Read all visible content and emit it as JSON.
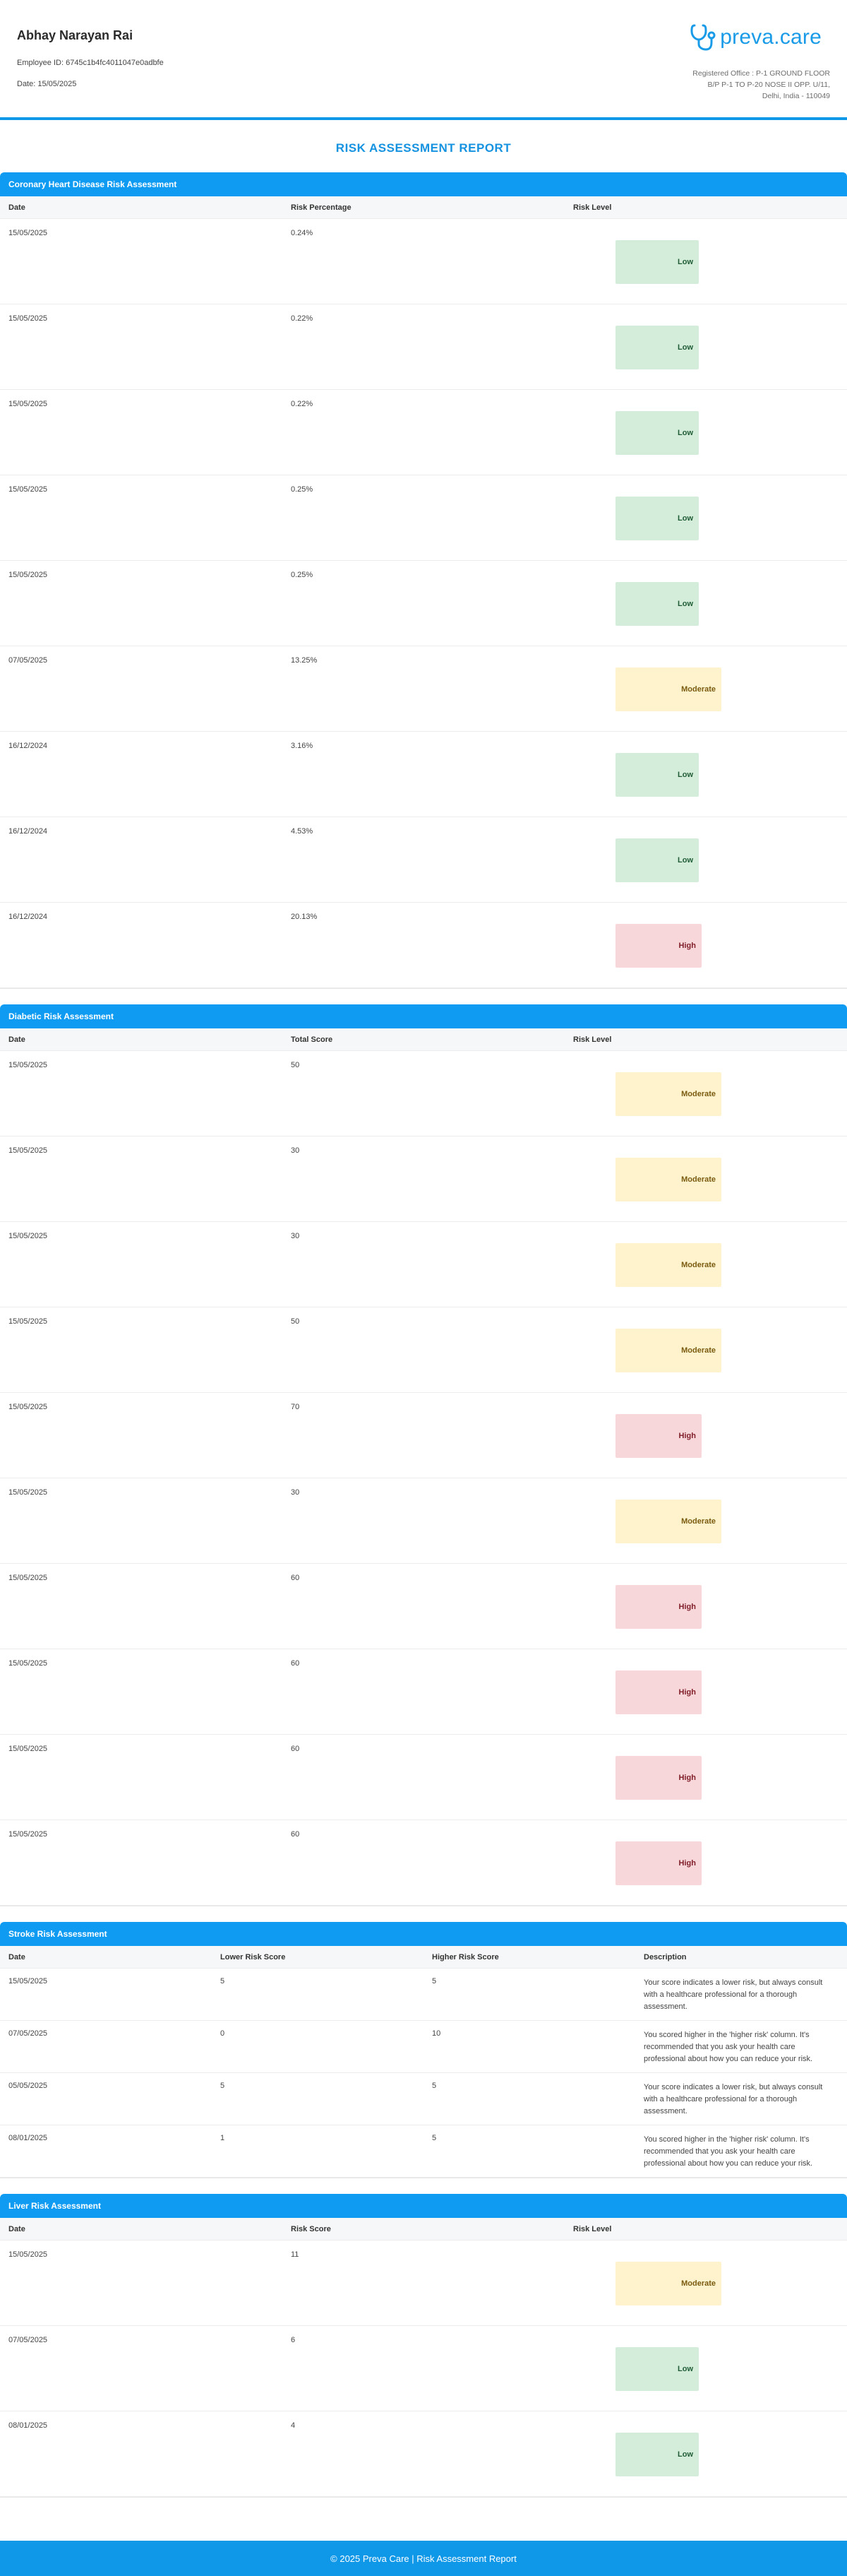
{
  "header": {
    "name": "Abhay Narayan Rai",
    "employee_id": "Employee ID: 6745c1b4fc4011047e0adbfe",
    "date": "Date: 15/05/2025",
    "logo_text": "preva.care",
    "address_lines": [
      "Registered Office : P-1 GROUND FLOOR",
      "B/P P-1 TO P-20 NOSE II OPP. U/11,",
      "Delhi, India - 110049"
    ]
  },
  "report_title": "RISK ASSESSMENT REPORT",
  "colors": {
    "accent": "#0f9bf1",
    "low_bg": "#d4eddb",
    "moderate_bg": "#fff3cd",
    "high_bg": "#f8d7da"
  },
  "coronary": {
    "title": "Coronary Heart Disease Risk Assessment",
    "headers": [
      "Date",
      "Risk Percentage",
      "Risk Level"
    ],
    "rows": [
      {
        "date": "15/05/2025",
        "value": "0.24%",
        "level": "Low"
      },
      {
        "date": "15/05/2025",
        "value": "0.22%",
        "level": "Low"
      },
      {
        "date": "15/05/2025",
        "value": "0.22%",
        "level": "Low"
      },
      {
        "date": "15/05/2025",
        "value": "0.25%",
        "level": "Low"
      },
      {
        "date": "15/05/2025",
        "value": "0.25%",
        "level": "Low"
      },
      {
        "date": "07/05/2025",
        "value": "13.25%",
        "level": "Moderate"
      },
      {
        "date": "16/12/2024",
        "value": "3.16%",
        "level": "Low"
      },
      {
        "date": "16/12/2024",
        "value": "4.53%",
        "level": "Low"
      },
      {
        "date": "16/12/2024",
        "value": "20.13%",
        "level": "High"
      }
    ]
  },
  "diabetic": {
    "title": "Diabetic Risk Assessment",
    "headers": [
      "Date",
      "Total Score",
      "Risk Level"
    ],
    "rows": [
      {
        "date": "15/05/2025",
        "value": "50",
        "level": "Moderate"
      },
      {
        "date": "15/05/2025",
        "value": "30",
        "level": "Moderate"
      },
      {
        "date": "15/05/2025",
        "value": "30",
        "level": "Moderate"
      },
      {
        "date": "15/05/2025",
        "value": "50",
        "level": "Moderate"
      },
      {
        "date": "15/05/2025",
        "value": "70",
        "level": "High"
      },
      {
        "date": "15/05/2025",
        "value": "30",
        "level": "Moderate"
      },
      {
        "date": "15/05/2025",
        "value": "60",
        "level": "High"
      },
      {
        "date": "15/05/2025",
        "value": "60",
        "level": "High"
      },
      {
        "date": "15/05/2025",
        "value": "60",
        "level": "High"
      },
      {
        "date": "15/05/2025",
        "value": "60",
        "level": "High"
      }
    ]
  },
  "stroke": {
    "title": "Stroke Risk Assessment",
    "headers": [
      "Date",
      "Lower Risk Score",
      "Higher Risk Score",
      "Description"
    ],
    "rows": [
      {
        "date": "15/05/2025",
        "lower": "5",
        "higher": "5",
        "description": "Your score indicates a lower risk, but always consult with a healthcare professional for a thorough assessment."
      },
      {
        "date": "07/05/2025",
        "lower": "0",
        "higher": "10",
        "description": "You scored higher in the 'higher risk' column. It's recommended that you ask your health care professional about how you can reduce your risk."
      },
      {
        "date": "05/05/2025",
        "lower": "5",
        "higher": "5",
        "description": "Your score indicates a lower risk, but always consult with a healthcare professional for a thorough assessment."
      },
      {
        "date": "08/01/2025",
        "lower": "1",
        "higher": "5",
        "description": "You scored higher in the 'higher risk' column. It's recommended that you ask your health care professional about how you can reduce your risk."
      }
    ]
  },
  "liver": {
    "title": "Liver Risk Assessment",
    "headers": [
      "Date",
      "Risk Score",
      "Risk Level"
    ],
    "rows": [
      {
        "date": "15/05/2025",
        "value": "11",
        "level": "Moderate"
      },
      {
        "date": "07/05/2025",
        "value": "6",
        "level": "Low"
      },
      {
        "date": "08/01/2025",
        "value": "4",
        "level": "Low"
      }
    ]
  },
  "footer": {
    "text": "© 2025 Preva Care | Risk Assessment Report"
  }
}
